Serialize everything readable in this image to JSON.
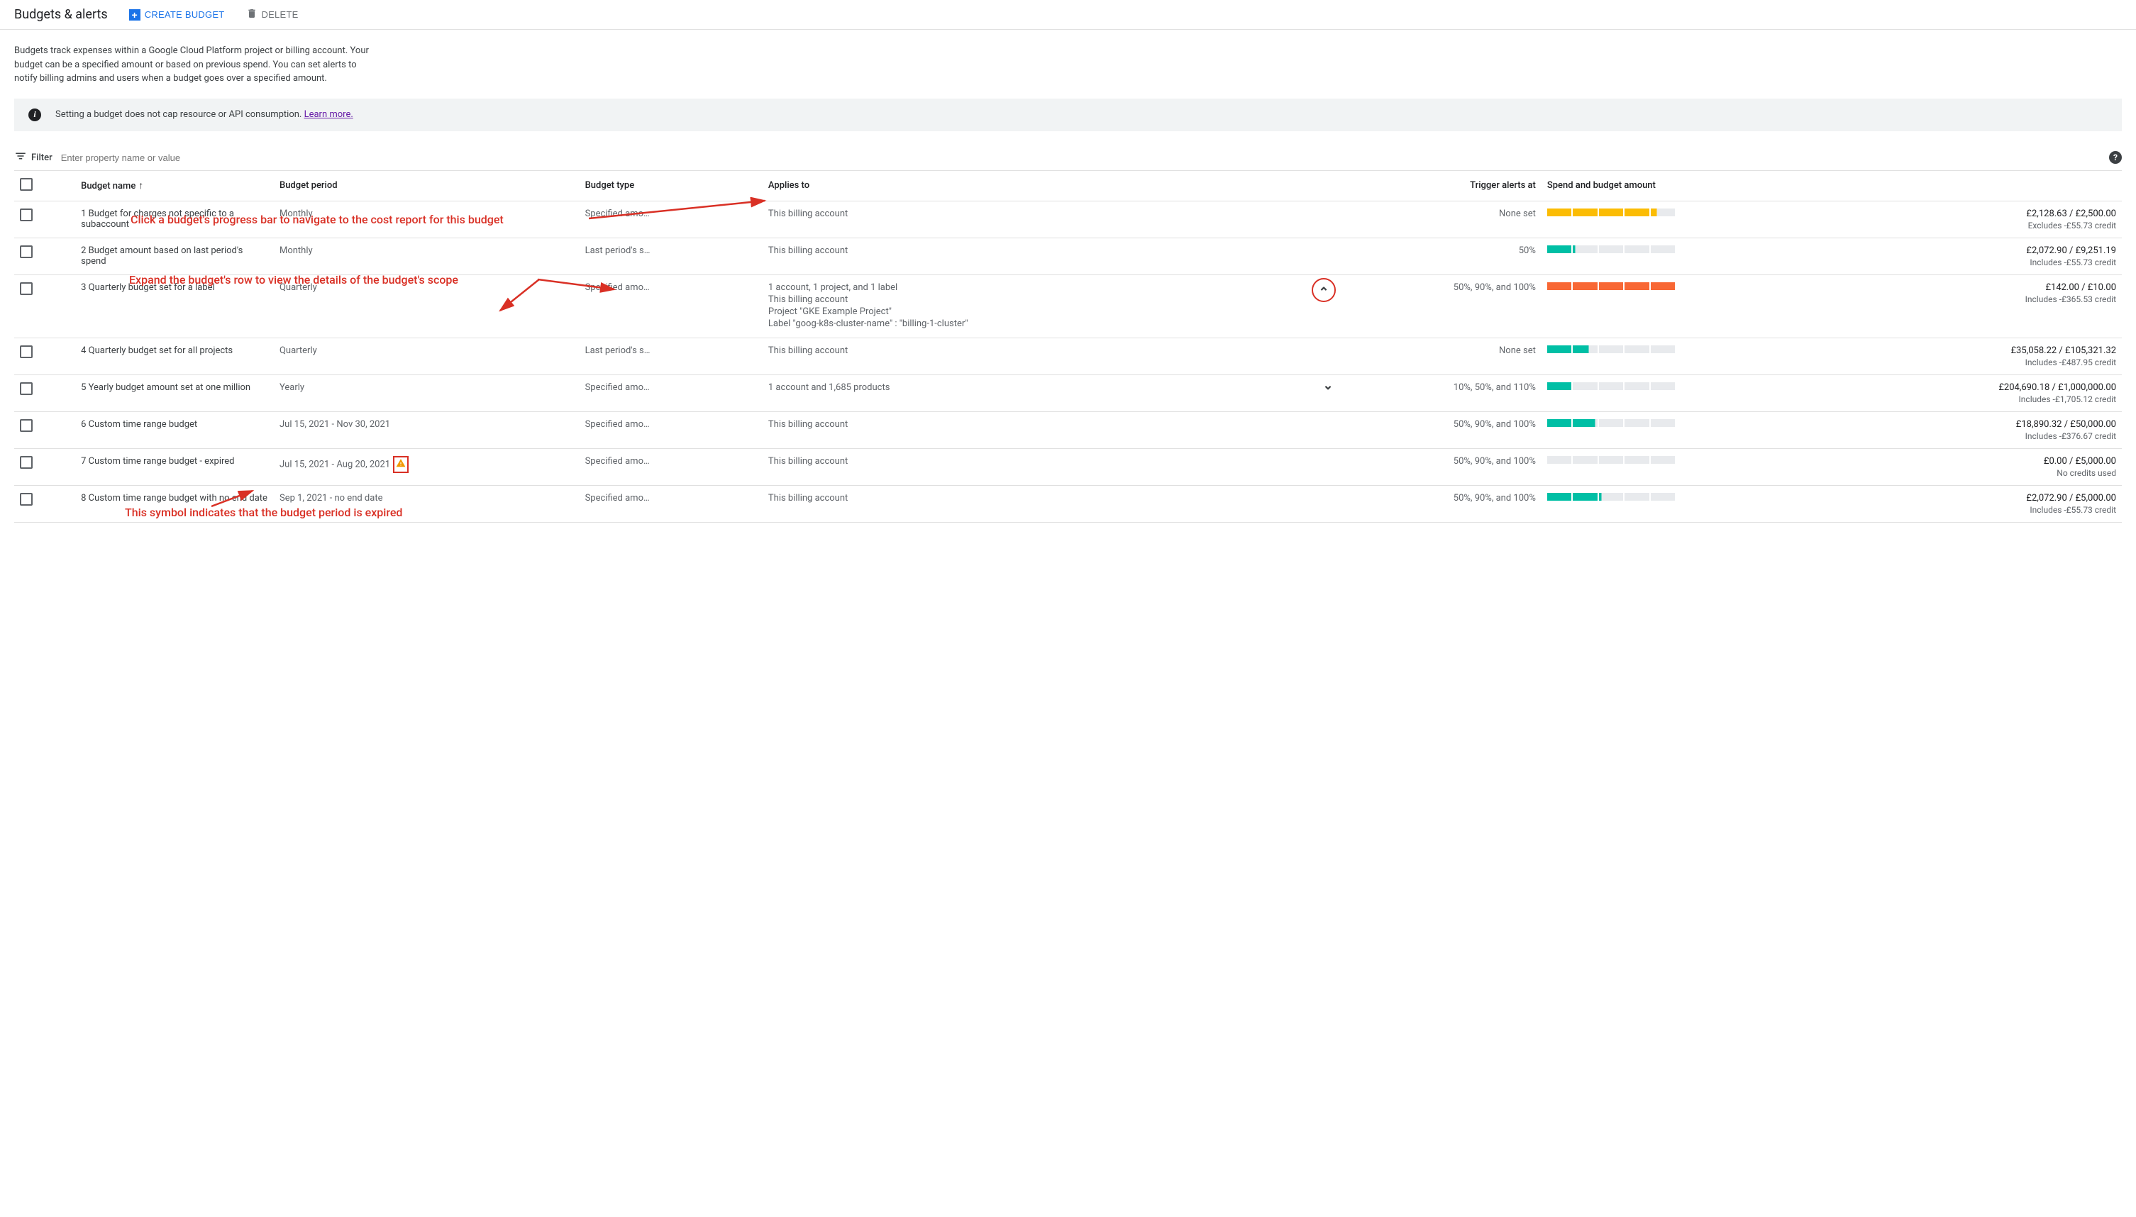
{
  "header": {
    "title": "Budgets & alerts",
    "create_label": "CREATE BUDGET",
    "delete_label": "DELETE"
  },
  "description": "Budgets track expenses within a Google Cloud Platform project or billing account. Your budget can be a specified amount or based on previous spend. You can set alerts to notify billing admins and users when a budget goes over a specified amount.",
  "banner": {
    "text": "Setting a budget does not cap resource or API consumption. ",
    "link_text": "Learn more."
  },
  "filter": {
    "label": "Filter",
    "placeholder": "Enter property name or value"
  },
  "columns": {
    "name": "Budget name",
    "period": "Budget period",
    "type": "Budget type",
    "applies": "Applies to",
    "trigger": "Trigger alerts at",
    "spend": "Spend and budget amount"
  },
  "callouts": {
    "progress": "Click a budget's progress bar to navigate to the cost report for this budget",
    "expand": "Expand the budget's row to view the details of the budget's scope",
    "expired": "This symbol indicates that the budget period is expired"
  },
  "rows": [
    {
      "idx": "1",
      "name": "Budget for charges not specific to a subaccount",
      "period": "Monthly",
      "type": "Specified amo…",
      "applies": [
        "This billing account"
      ],
      "trigger": "None set",
      "amount": "£2,128.63 / £2,500.00",
      "credit": "Excludes -£55.73 credit",
      "progress": {
        "filled": 4.25,
        "total": 5,
        "color": "yellow"
      },
      "expand": null
    },
    {
      "idx": "2",
      "name": "Budget amount based on last period's spend",
      "period": "Monthly",
      "type": "Last period's s…",
      "applies": [
        "This billing account"
      ],
      "trigger": "50%",
      "amount": "£2,072.90 / £9,251.19",
      "credit": "Includes -£55.73 credit",
      "progress": {
        "filled": 1.1,
        "total": 5,
        "color": "teal"
      },
      "expand": null
    },
    {
      "idx": "3",
      "name": "Quarterly budget set for a label",
      "period": "Quarterly",
      "type": "Specified amo…",
      "applies": [
        "1 account, 1 project, and 1 label",
        "This billing account",
        "Project \"GKE Example Project\"",
        "Label \"goog-k8s-cluster-name\" : \"billing-1-cluster\""
      ],
      "trigger": "50%, 90%, and 100%",
      "amount": "£142.00 / £10.00",
      "credit": "Includes -£365.53 credit",
      "progress": {
        "filled": 5,
        "total": 5,
        "color": "orange"
      },
      "expand": "up-circled"
    },
    {
      "idx": "4",
      "name": "Quarterly budget set for all projects",
      "period": "Quarterly",
      "type": "Last period's s…",
      "applies": [
        "This billing account"
      ],
      "trigger": "None set",
      "amount": "£35,058.22 / £105,321.32",
      "credit": "Includes -£487.95 credit",
      "progress": {
        "filled": 1.65,
        "total": 5,
        "color": "teal"
      },
      "expand": null
    },
    {
      "idx": "5",
      "name": "Yearly budget amount set at one million",
      "period": "Yearly",
      "type": "Specified amo…",
      "applies": [
        "1 account and 1,685 products"
      ],
      "trigger": "10%, 50%, and 110%",
      "amount": "£204,690.18 / £1,000,000.00",
      "credit": "Includes -£1,705.12 credit",
      "progress": {
        "filled": 1.0,
        "total": 5,
        "color": "teal"
      },
      "expand": "down"
    },
    {
      "idx": "6",
      "name": "Custom time range budget",
      "period": "Jul 15, 2021 - Nov 30, 2021",
      "type": "Specified amo…",
      "applies": [
        "This billing account"
      ],
      "trigger": "50%, 90%, and 100%",
      "amount": "£18,890.32 / £50,000.00",
      "credit": "Includes -£376.67 credit",
      "progress": {
        "filled": 1.9,
        "total": 5,
        "color": "teal"
      },
      "expand": null
    },
    {
      "idx": "7",
      "name": "Custom time range budget - expired",
      "period": "Jul 15, 2021 - Aug 20, 2021",
      "type": "Specified amo…",
      "applies": [
        "This billing account"
      ],
      "trigger": "50%, 90%, and 100%",
      "amount": "£0.00 / £5,000.00",
      "credit": "No credits used",
      "progress": {
        "filled": 0,
        "total": 5,
        "color": "grey"
      },
      "expand": null,
      "expired": true
    },
    {
      "idx": "8",
      "name": "Custom time range budget with no end date",
      "period": "Sep 1, 2021 - no end date",
      "type": "Specified amo…",
      "applies": [
        "This billing account"
      ],
      "trigger": "50%, 90%, and 100%",
      "amount": "£2,072.90 / £5,000.00",
      "credit": "Includes -£55.73 credit",
      "progress": {
        "filled": 2.1,
        "total": 5,
        "color": "teal"
      },
      "expand": null
    }
  ]
}
